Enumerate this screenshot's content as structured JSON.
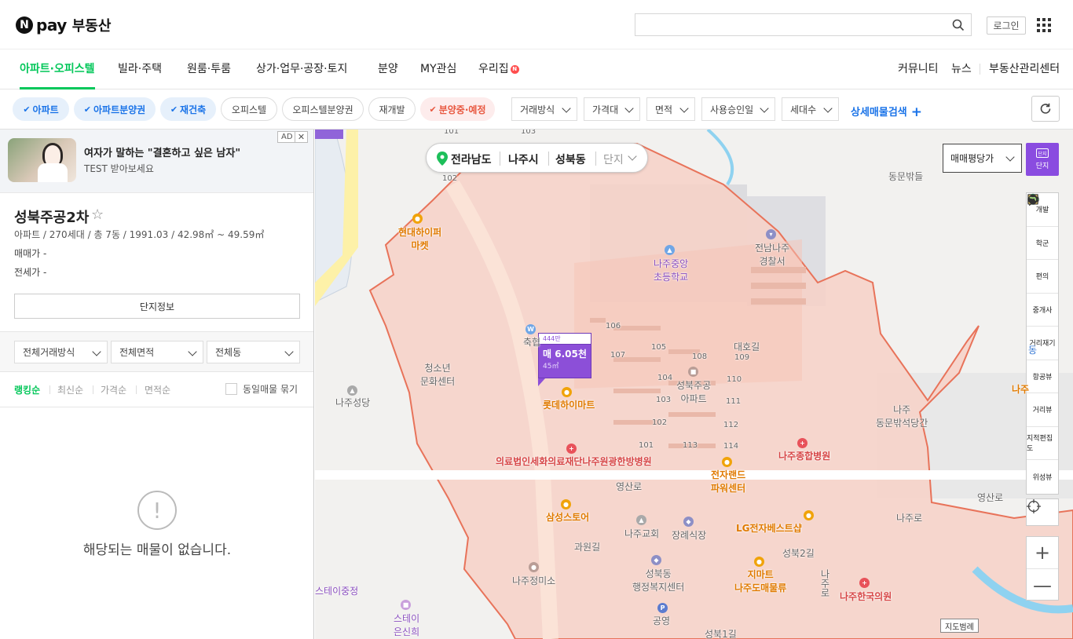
{
  "header": {
    "logo_n": "N",
    "logo_pay": "pay",
    "logo_text": "부동산",
    "search_placeholder": "",
    "login_label": "로그인"
  },
  "gnb": {
    "tabs": [
      "아파트·오피스텔",
      "빌라·주택",
      "원룸·투룸",
      "상가·업무·공장·토지",
      "분양",
      "MY관심",
      "우리집"
    ],
    "new_badge": "N",
    "right_links": [
      "커뮤니티",
      "뉴스",
      "부동산관리센터"
    ]
  },
  "filters": {
    "chips": [
      "아파트",
      "아파트분양권",
      "재건축",
      "오피스텔",
      "오피스텔분양권",
      "재개발",
      "분양중·예정"
    ],
    "dropdowns": [
      "거래방식",
      "가격대",
      "면적",
      "사용승인일",
      "세대수"
    ],
    "detail_search": "상세매물검색",
    "colors": {
      "active_chip": "#1a73e8",
      "presale_chip": "#e8573f",
      "brand": "#03c75a"
    }
  },
  "ad": {
    "title": "여자가 말하는 \"결혼하고 싶은 남자\"",
    "subtitle": "TEST 받아보세요",
    "tag": "AD",
    "close": "✕"
  },
  "complex": {
    "name": "성북주공2차",
    "star": "☆",
    "info": "아파트 / 270세대 / 총 7동 / 1991.03 / 42.98㎡ ~ 49.59㎡",
    "sale_label": "매매가",
    "sale_value": "-",
    "jeonse_label": "전세가",
    "jeonse_value": "-",
    "info_button": "단지정보"
  },
  "trade_filters": [
    "전체거래방식",
    "전체면적",
    "전체동"
  ],
  "sort": {
    "options": [
      "랭킹순",
      "최신순",
      "가격순",
      "면적순"
    ],
    "same_listing": "동일매물 묶기"
  },
  "empty": {
    "icon": "!",
    "message": "해당되는 매물이 없습니다."
  },
  "map": {
    "location": {
      "province": "전라남도",
      "city": "나주시",
      "dong": "성북동",
      "complex": "단지"
    },
    "price_select": "매매평당가",
    "complex_toggle": {
      "icon": "단지",
      "label": "단지"
    },
    "tools": [
      "개발",
      "학군",
      "편의",
      "중개사",
      "거리재기",
      "항공뷰",
      "거리뷰",
      "지적편집도",
      "위성뷰"
    ],
    "scale_label": "지도범례",
    "zoom_in": "+",
    "zoom_out": "—",
    "marker": {
      "top": "444만",
      "price": "매 6.05천",
      "area": "45㎡"
    },
    "labels": {
      "hyundai_mart": "현대하이퍼\n마켓",
      "najuchungang": "나주중앙\n초등학교",
      "jeonnam_police": "전남나주\n경찰서",
      "dongmun": "동문밖들",
      "chukhyup": "축협",
      "youth_center": "청소년\n문화센터",
      "naju_church": "나주성당",
      "lotte_mart": "롯데하이마트",
      "seongbuk_apt": "성북주공\n아파트",
      "daeho": "대호길",
      "naju_dongmun": "나주\n동문밖석당간",
      "hospital_1": "의료법인세화의료재단나주원광한방병원",
      "naju_hospital": "나주종합병원",
      "electroland": "전자랜드\n파워센터",
      "yeongsanro": "영산로",
      "yeongsanro2": "영산로",
      "samsung": "삼성스토어",
      "naju_kyohoe": "나주교회",
      "funeral": "장례식장",
      "lg": "LG전자베스트샵",
      "najuro": "나주로",
      "gwawongil": "과원길",
      "seongbuk_office": "성북동\n행정복지센터",
      "gs": "지마트\n나주도매물류",
      "najeongmiso": "나주정미소",
      "gongyeong": "공영",
      "naju_hanguk": "나주한국의원",
      "stay_jung": "스테이중정",
      "stay_eun": "스테이\n은신희",
      "seongbuk2": "성북2길",
      "seongbuk1": "성북1길",
      "najuro2": "나주로",
      "dong_top": "동",
      "naju_right": "나주",
      "bldg": [
        "101",
        "103",
        "102",
        "106",
        "105",
        "107",
        "108",
        "109",
        "104",
        "110",
        "103",
        "111",
        "102",
        "112",
        "101",
        "113",
        "114"
      ]
    },
    "colors": {
      "zone_fill": "#f6d0c4",
      "zone_border": "#e8735a",
      "marker": "#8c4fd8"
    }
  }
}
